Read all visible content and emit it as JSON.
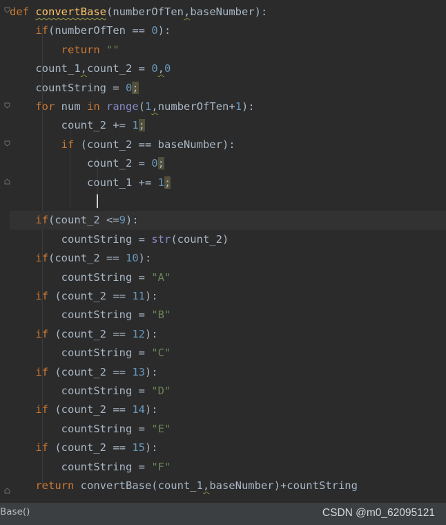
{
  "editor": {
    "lines": [
      [
        [
          "kw",
          "def"
        ],
        [
          "t",
          " "
        ],
        [
          "fn",
          "convertBase"
        ],
        [
          "t",
          "(numberOfTen"
        ],
        [
          "sq",
          ","
        ],
        [
          "t",
          "baseNumber):"
        ]
      ],
      [
        [
          "t",
          "    "
        ],
        [
          "kw",
          "if"
        ],
        [
          "t",
          "(numberOfTen == "
        ],
        [
          "num",
          "0"
        ],
        [
          "t",
          "):"
        ]
      ],
      [
        [
          "t",
          "        "
        ],
        [
          "kw",
          "return"
        ],
        [
          "t",
          " "
        ],
        [
          "str",
          "\"\""
        ]
      ],
      [
        [
          "t",
          "    count_1"
        ],
        [
          "sq",
          ","
        ],
        [
          "t",
          "count_2 = "
        ],
        [
          "num",
          "0"
        ],
        [
          "sq",
          ","
        ],
        [
          "num",
          "0"
        ]
      ],
      [
        [
          "t",
          "    countString = "
        ],
        [
          "num",
          "0"
        ],
        [
          "semi",
          ";"
        ]
      ],
      [
        [
          "t",
          "    "
        ],
        [
          "kw",
          "for"
        ],
        [
          "t",
          " num "
        ],
        [
          "kw",
          "in"
        ],
        [
          "t",
          " "
        ],
        [
          "bi",
          "range"
        ],
        [
          "t",
          "("
        ],
        [
          "num",
          "1"
        ],
        [
          "sq",
          ","
        ],
        [
          "t",
          "numberOfTen+"
        ],
        [
          "num",
          "1"
        ],
        [
          "t",
          "):"
        ]
      ],
      [
        [
          "t",
          "        count_2 += "
        ],
        [
          "num",
          "1"
        ],
        [
          "semi",
          ";"
        ]
      ],
      [
        [
          "t",
          "        "
        ],
        [
          "kw",
          "if"
        ],
        [
          "t",
          " (count_2 == baseNumber):"
        ]
      ],
      [
        [
          "t",
          "            count_2 = "
        ],
        [
          "num",
          "0"
        ],
        [
          "semi",
          ";"
        ]
      ],
      [
        [
          "t",
          "            count_1 += "
        ],
        [
          "num",
          "1"
        ],
        [
          "semi",
          ";"
        ]
      ],
      [
        [
          "t",
          ""
        ]
      ],
      [
        [
          "t",
          "    "
        ],
        [
          "kw",
          "if"
        ],
        [
          "t",
          "(count_2 <="
        ],
        [
          "num",
          "9"
        ],
        [
          "t",
          "):"
        ]
      ],
      [
        [
          "t",
          "        countString = "
        ],
        [
          "bi",
          "str"
        ],
        [
          "t",
          "(count_2)"
        ]
      ],
      [
        [
          "t",
          "    "
        ],
        [
          "kw",
          "if"
        ],
        [
          "t",
          "(count_2 == "
        ],
        [
          "num",
          "10"
        ],
        [
          "t",
          "):"
        ]
      ],
      [
        [
          "t",
          "        countString = "
        ],
        [
          "str",
          "\"A\""
        ]
      ],
      [
        [
          "t",
          "    "
        ],
        [
          "kw",
          "if"
        ],
        [
          "t",
          " (count_2 == "
        ],
        [
          "num",
          "11"
        ],
        [
          "t",
          "):"
        ]
      ],
      [
        [
          "t",
          "        countString = "
        ],
        [
          "str",
          "\"B\""
        ]
      ],
      [
        [
          "t",
          "    "
        ],
        [
          "kw",
          "if"
        ],
        [
          "t",
          " (count_2 == "
        ],
        [
          "num",
          "12"
        ],
        [
          "t",
          "):"
        ]
      ],
      [
        [
          "t",
          "        countString = "
        ],
        [
          "str",
          "\"C\""
        ]
      ],
      [
        [
          "t",
          "    "
        ],
        [
          "kw",
          "if"
        ],
        [
          "t",
          " (count_2 == "
        ],
        [
          "num",
          "13"
        ],
        [
          "t",
          "):"
        ]
      ],
      [
        [
          "t",
          "        countString = "
        ],
        [
          "str",
          "\"D\""
        ]
      ],
      [
        [
          "t",
          "    "
        ],
        [
          "kw",
          "if"
        ],
        [
          "t",
          " (count_2 == "
        ],
        [
          "num",
          "14"
        ],
        [
          "t",
          "):"
        ]
      ],
      [
        [
          "t",
          "        countString = "
        ],
        [
          "str",
          "\"E\""
        ]
      ],
      [
        [
          "t",
          "    "
        ],
        [
          "kw",
          "if"
        ],
        [
          "t",
          " (count_2 == "
        ],
        [
          "num",
          "15"
        ],
        [
          "t",
          "):"
        ]
      ],
      [
        [
          "t",
          "        countString = "
        ],
        [
          "str",
          "\"F\""
        ]
      ],
      [
        [
          "t",
          "    "
        ],
        [
          "kw",
          "return"
        ],
        [
          "t",
          " convertBase(count_1"
        ],
        [
          "sq",
          ","
        ],
        [
          "t",
          "baseNumber)+countString"
        ]
      ]
    ],
    "current_line": 11
  },
  "statusbar": {
    "breadcrumb": "Base()",
    "watermark": "CSDN @m0_62095121"
  },
  "colors": {
    "background": "#2b2b2b",
    "keyword": "#cc7832",
    "function": "#ffc66d",
    "number": "#6897bb",
    "string": "#6a8759",
    "builtin": "#8888c6",
    "text": "#a9b7c6"
  }
}
